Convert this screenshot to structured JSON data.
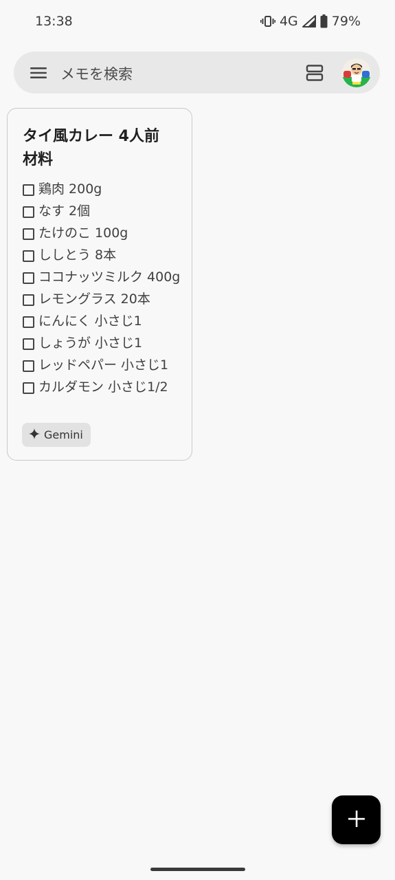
{
  "status_bar": {
    "time": "13:38",
    "network": "4G",
    "battery": "79%",
    "icons": [
      "vibrate-icon",
      "signal-icon",
      "battery-icon"
    ]
  },
  "search": {
    "placeholder": "メモを検索",
    "icons": [
      "menu-icon",
      "layout-toggle-icon",
      "avatar"
    ]
  },
  "note": {
    "title_line1": "タイ風カレー 4人前",
    "title_line2": "材料",
    "items": [
      {
        "text": "鶏肉 200g",
        "checked": false
      },
      {
        "text": "なす 2個",
        "checked": false
      },
      {
        "text": "たけのこ 100g",
        "checked": false
      },
      {
        "text": "ししとう 8本",
        "checked": false
      },
      {
        "text": "ココナッツミルク 400g",
        "checked": false
      },
      {
        "text": "レモングラス 20本",
        "checked": false
      },
      {
        "text": "にんにく 小さじ1",
        "checked": false
      },
      {
        "text": "しょうが 小さじ1",
        "checked": false
      },
      {
        "text": "レッドペパー 小さじ1",
        "checked": false
      },
      {
        "text": "カルダモン 小さじ1/2",
        "checked": false
      }
    ],
    "chip": {
      "label": "Gemini",
      "icon": "sparkle-icon"
    }
  },
  "fab": {
    "icon": "plus-icon"
  },
  "colors": {
    "background": "#f8f8f8",
    "search_bar": "#e8e8e8",
    "fab": "#000000",
    "chip": "#e2e2e2"
  }
}
